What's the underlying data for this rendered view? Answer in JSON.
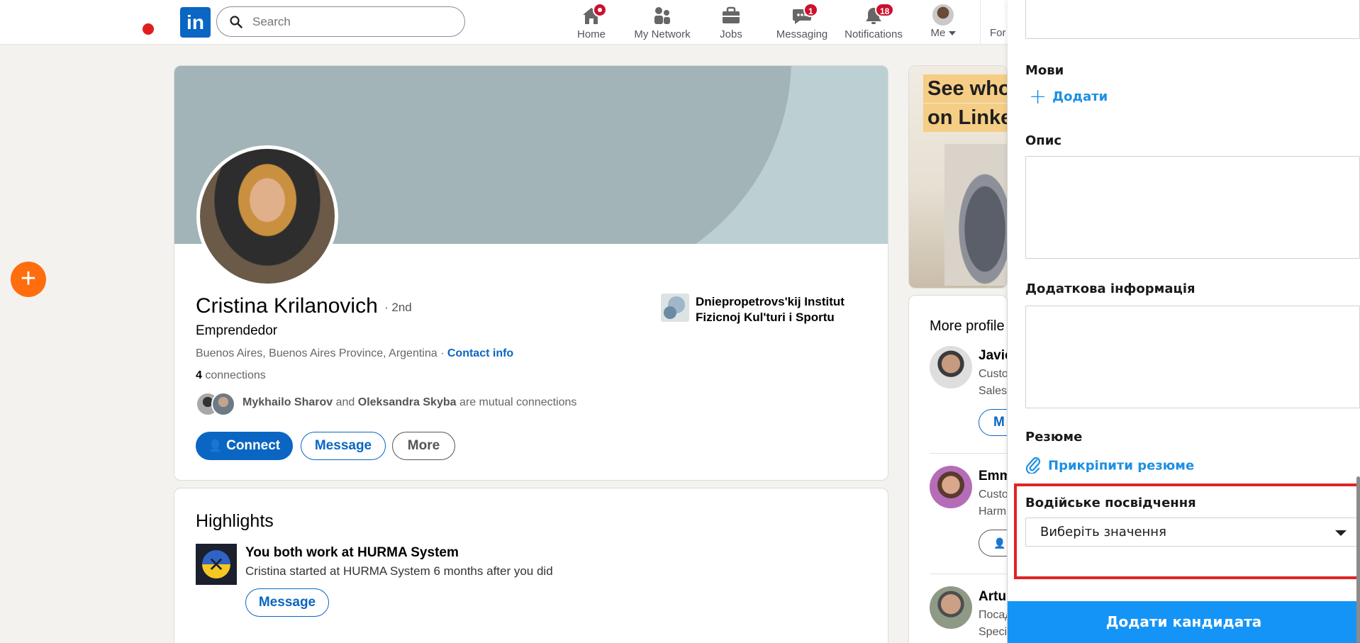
{
  "nav": {
    "search_placeholder": "Search",
    "items": [
      {
        "label": "Home",
        "badge": ""
      },
      {
        "label": "My Network",
        "badge": ""
      },
      {
        "label": "Jobs",
        "badge": ""
      },
      {
        "label": "Messaging",
        "badge": "1"
      },
      {
        "label": "Notifications",
        "badge": "18"
      },
      {
        "label": "Me",
        "badge": ""
      }
    ],
    "for_business": "For"
  },
  "profile": {
    "name": "Cristina Krilanovich",
    "degree": "· 2nd",
    "headline": "Emprendedor",
    "location": "Buenos Aires, Buenos Aires Province, Argentina ·",
    "contact_info": "Contact info",
    "connections_count": "4",
    "connections_label": "connections",
    "mutual_1": "Mykhailo Sharov",
    "mutual_and": "and",
    "mutual_2": "Oleksandra Skyba",
    "mutual_suffix": "are mutual connections",
    "school": "Dniepropetrovs'kij Institut Fizicnoj Kul'turi i Sportu",
    "buttons": {
      "connect": "Connect",
      "message": "Message",
      "more": "More"
    }
  },
  "highlights": {
    "title": "Highlights",
    "headline": "You both work at HURMA System",
    "sub": "Cristina started at HURMA System 6 months after you did",
    "button": "Message"
  },
  "ad": {
    "line1": "See who",
    "line2": "on Linked"
  },
  "more_profiles": {
    "title": "More profile",
    "people": [
      {
        "name": "Javie",
        "line1": "Custo",
        "line2": "Sales",
        "button": "M"
      },
      {
        "name": "Emm",
        "line1": "Custo",
        "line2": "Harm",
        "button": ""
      },
      {
        "name": "Artu",
        "line1": "Посад",
        "line2": "Speci",
        "button": ""
      }
    ]
  },
  "panel": {
    "languages_label": "Мови",
    "add_label": "Додати",
    "description_label": "Опис",
    "additional_label": "Додаткова інформація",
    "resume_label": "Резюме",
    "attach_resume": "Прикріпити резюме",
    "license_label": "Водійське посвідчення",
    "license_select": "Виберіть значення",
    "submit": "Додати кандидата"
  },
  "colors": {
    "linkedin_blue": "#0a66c2",
    "panel_blue": "#1494f6",
    "highlight_red": "#e02424",
    "badge_red": "#cb112d",
    "fab_orange": "#ff6d0e"
  }
}
